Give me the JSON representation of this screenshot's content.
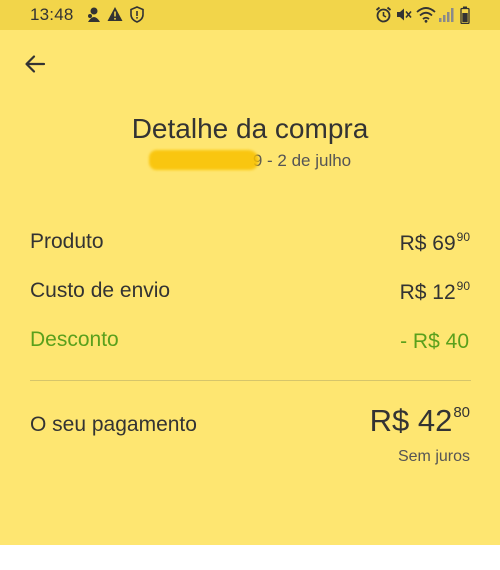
{
  "status_bar": {
    "time": "13:48",
    "left_icons": [
      "notification-icon",
      "warning-icon",
      "shield-icon"
    ],
    "right_icons": [
      "alarm-icon",
      "mute-icon",
      "wifi-icon",
      "signal-icon",
      "battery-icon"
    ]
  },
  "header": {
    "back_icon": "arrow-left-icon",
    "title": "Detalhe da compra",
    "subtitle_date": "9 - 2 de julho"
  },
  "breakdown": [
    {
      "label": "Produto",
      "currency": "R$",
      "amount": "69",
      "cents": "90",
      "highlight": false
    },
    {
      "label": "Custo de envio",
      "currency": "R$",
      "amount": "12",
      "cents": "90",
      "highlight": false
    },
    {
      "label": "Desconto",
      "currency": "- R$",
      "amount": "40",
      "cents": "",
      "highlight": true
    }
  ],
  "payment": {
    "label": "O seu pagamento",
    "currency": "R$",
    "amount": "42",
    "cents": "80",
    "note": "Sem juros"
  },
  "colors": {
    "background": "#fee671",
    "status_bar": "#f2d54a",
    "discount": "#5aa01c",
    "text": "#333333"
  }
}
